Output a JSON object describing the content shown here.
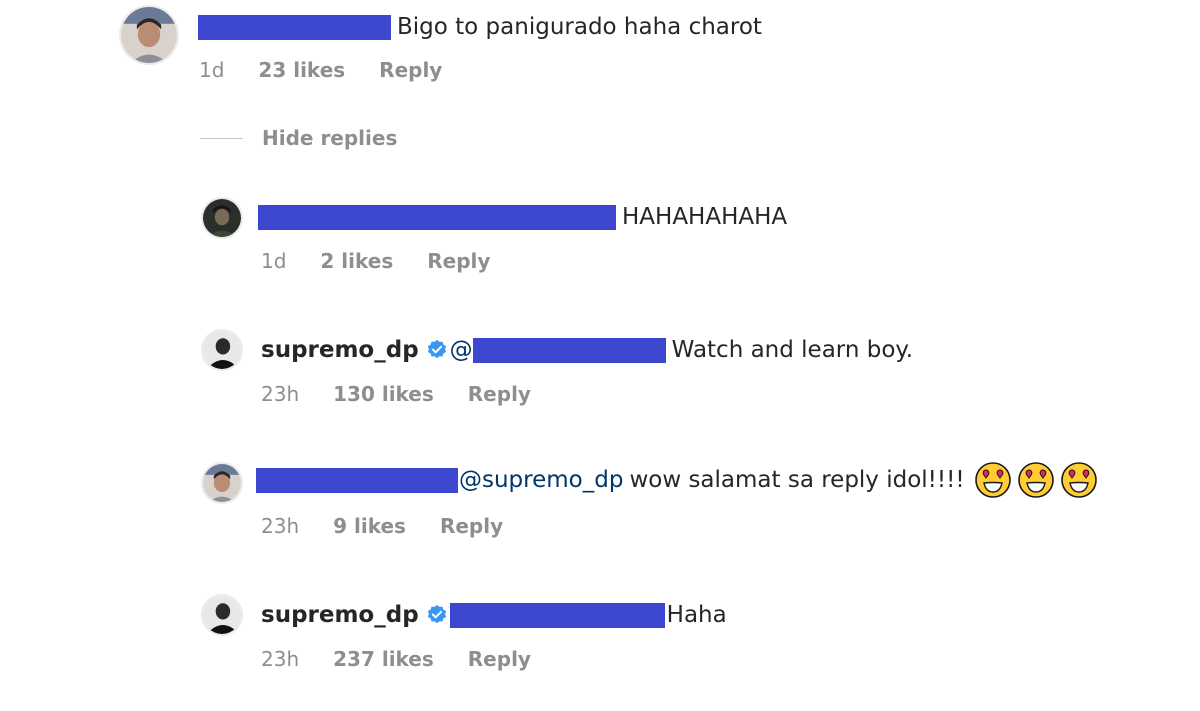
{
  "colors": {
    "redaction": "#3d47d0",
    "muted": "#8e8e8e",
    "mention": "#00376b",
    "verified": "#3897f0"
  },
  "top_comment": {
    "avatar_icon": "user-avatar-photo",
    "text": "Bigo to panigurado haha charot",
    "time": "1d",
    "likes": "23 likes",
    "reply_label": "Reply"
  },
  "hide_replies_label": "Hide replies",
  "replies": [
    {
      "avatar_icon": "user-avatar-photo",
      "text": "HAHAHAHAHA",
      "time": "1d",
      "likes": "2 likes",
      "reply_label": "Reply"
    },
    {
      "avatar_icon": "user-avatar-photo",
      "username": "supremo_dp",
      "verified": true,
      "mention_prefix": "@",
      "text": "Watch and learn boy.",
      "time": "23h",
      "likes": "130 likes",
      "reply_label": "Reply"
    },
    {
      "avatar_icon": "user-avatar-photo",
      "mention": "@supremo_dp",
      "text": "wow salamat sa reply idol!!!!",
      "emojis": [
        "heart-eyes-emoji",
        "heart-eyes-emoji",
        "heart-eyes-emoji"
      ],
      "time": "23h",
      "likes": "9 likes",
      "reply_label": "Reply"
    },
    {
      "avatar_icon": "user-avatar-photo",
      "username": "supremo_dp",
      "verified": true,
      "text": "Haha",
      "time": "23h",
      "likes": "237 likes",
      "reply_label": "Reply"
    }
  ]
}
